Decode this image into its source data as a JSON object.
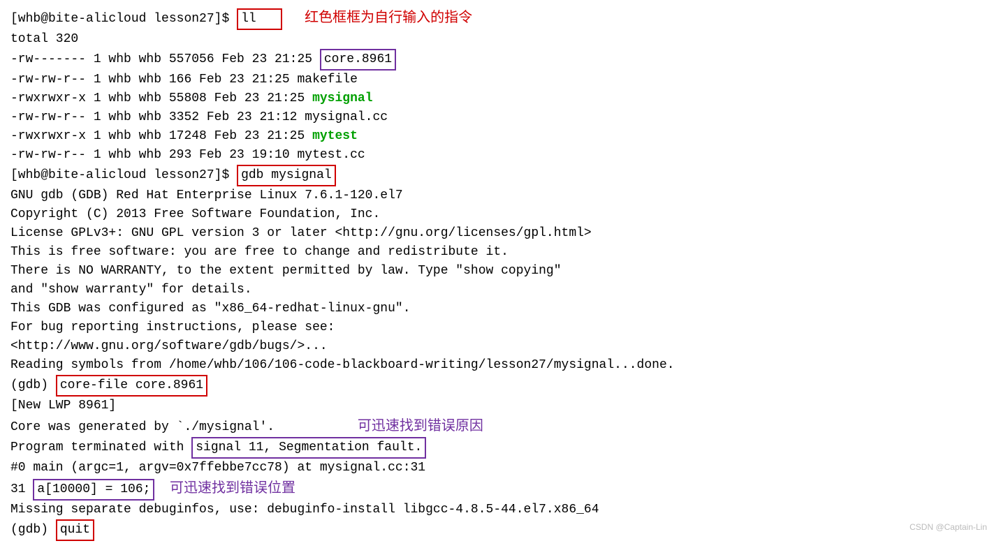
{
  "prompt1": "[whb@bite-alicloud lesson27]$ ",
  "cmd_ll": "ll",
  "red_annotation": "红色框框为自行输入的指令",
  "total_line": "total 320",
  "file1a": "-rw------- 1 whb whb 557056 Feb 23 21:25 ",
  "file1b": "core.8961",
  "file2": "-rw-rw-r-- 1 whb whb    166 Feb 23 21:25 makefile",
  "file3a": "-rwxrwxr-x 1 whb whb  55808 Feb 23 21:25 ",
  "file3b": "mysignal",
  "file4": "-rw-rw-r-- 1 whb whb   3352 Feb 23 21:12 mysignal.cc",
  "file5a": "-rwxrwxr-x 1 whb whb  17248 Feb 23 21:25 ",
  "file5b": "mytest",
  "file6": "-rw-rw-r-- 1 whb whb    293 Feb 23 19:10 mytest.cc",
  "prompt2": "[whb@bite-alicloud lesson27]$ ",
  "cmd_gdb": "gdb mysignal",
  "gdb1": "GNU gdb (GDB) Red Hat Enterprise Linux 7.6.1-120.el7",
  "gdb2": "Copyright (C) 2013 Free Software Foundation, Inc.",
  "gdb3": "License GPLv3+: GNU GPL version 3 or later <http://gnu.org/licenses/gpl.html>",
  "gdb4": "This is free software: you are free to change and redistribute it.",
  "gdb5": "There is NO WARRANTY, to the extent permitted by law.  Type \"show copying\"",
  "gdb6": "and \"show warranty\" for details.",
  "gdb7": "This GDB was configured as \"x86_64-redhat-linux-gnu\".",
  "gdb8": "For bug reporting instructions, please see:",
  "gdb9": "<http://www.gnu.org/software/gdb/bugs/>...",
  "gdb10": "Reading symbols from /home/whb/106/106-code-blackboard-writing/lesson27/mysignal...done.",
  "gdb_prompt1": "(gdb) ",
  "cmd_core": "core-file core.8961",
  "lwp": "[New LWP 8961]",
  "coregen": "Core was generated by `./mysignal'.",
  "purple_annotation1": "可迅速找到错误原因",
  "progterm_a": "Program terminated with ",
  "progterm_b": "signal 11, Segmentation fault.",
  "frame0": "#0  main (argc=1, argv=0x7ffebbe7cc78) at mysignal.cc:31",
  "line31a": "31              ",
  "line31b": "a[10000] = 106;",
  "purple_annotation2": "可迅速找到错误位置",
  "missing": "Missing separate debuginfos, use: debuginfo-install libgcc-4.8.5-44.el7.x86_64",
  "gdb_prompt2": "(gdb) ",
  "cmd_quit": "quit",
  "watermark": "CSDN @Captain-Lin"
}
